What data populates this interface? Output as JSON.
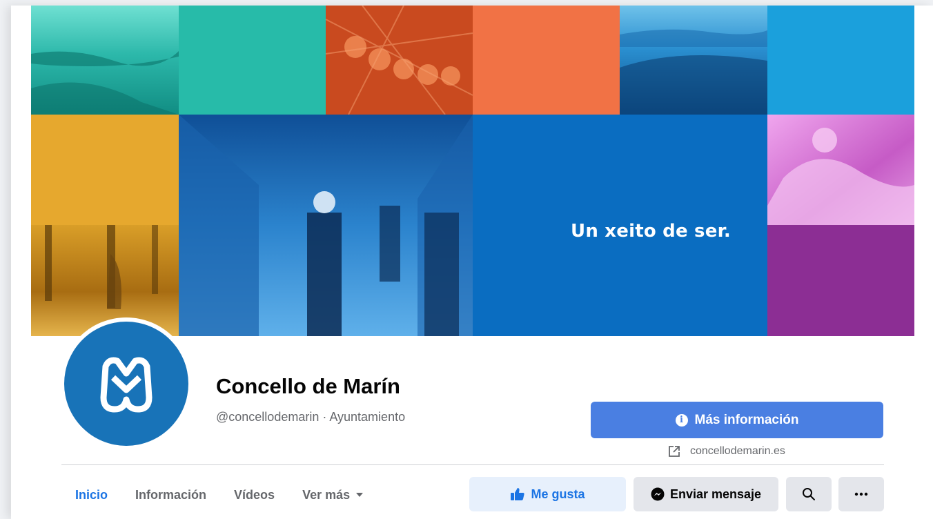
{
  "cover": {
    "tagline": "Un xeito de ser."
  },
  "profile": {
    "name": "Concello de Marín",
    "handle": "@concellodemarin · Ayuntamiento"
  },
  "cta": {
    "info_label": "Más información",
    "website": "concellodemarin.es"
  },
  "tabs": [
    {
      "label": "Inicio",
      "active": true
    },
    {
      "label": "Información",
      "active": false
    },
    {
      "label": "Vídeos",
      "active": false
    },
    {
      "label": "Ver más",
      "active": false
    }
  ],
  "actions": {
    "like_label": "Me gusta",
    "message_label": "Enviar mensaje",
    "search_icon": "search-icon",
    "more_icon": "more-icon"
  },
  "colors": {
    "accent": "#1b74e4",
    "primary_button": "#4a7fe2",
    "logo_blue": "#1873b8",
    "tile_teal": "#27bba9",
    "tile_orange": "#f17245",
    "tile_sky": "#1ba0dc",
    "tile_amber": "#e6a82e",
    "tile_blue": "#0a6dc1",
    "tile_purple": "#8c2e94"
  }
}
